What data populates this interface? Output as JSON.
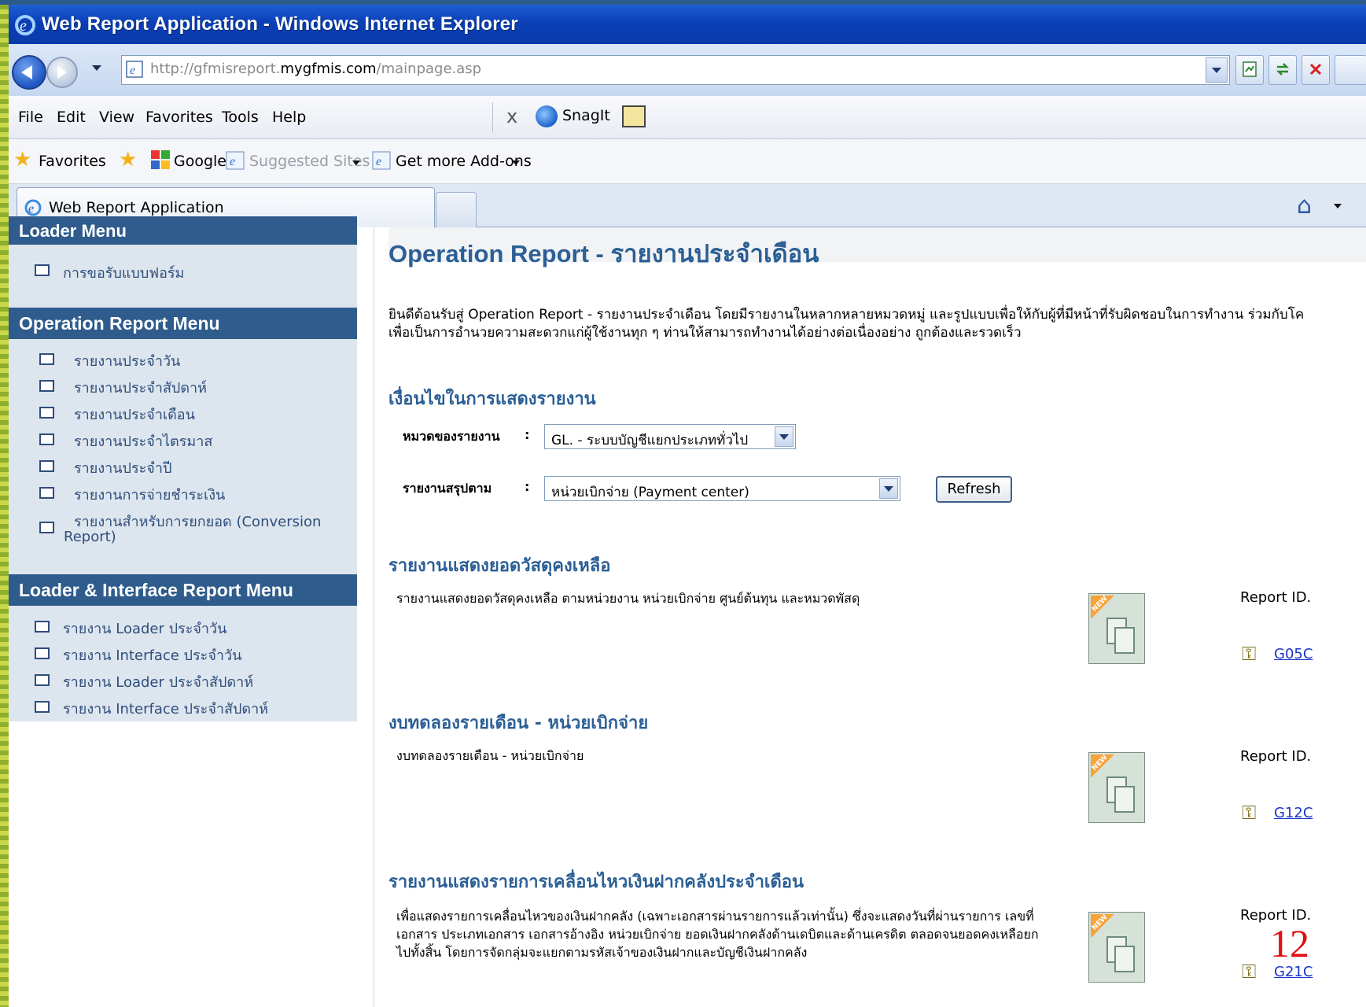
{
  "window": {
    "title": "Web Report Application - Windows Internet Explorer"
  },
  "address": {
    "url_prefix": "http://gfmisreport.",
    "url_domain": "mygfmis.com",
    "url_suffix": "/mainpage.asp"
  },
  "menubar": {
    "items": [
      "File",
      "Edit",
      "View",
      "Favorites",
      "Tools",
      "Help"
    ],
    "close_glyph": "x",
    "snagit_label": "SnagIt"
  },
  "favbar": {
    "favorites_label": "Favorites",
    "google_label": "Google",
    "suggested_label": "Suggested Sites",
    "addons_label": "Get more Add-ons"
  },
  "tabs": {
    "active_label": "Web Report Application"
  },
  "sidebar": {
    "loader_head": "Loader Menu",
    "loader_items": [
      "การขอรับแบบฟอร์ม"
    ],
    "operation_head": "Operation Report Menu",
    "operation_items": [
      "รายงานประจำวัน",
      "รายงานประจำสัปดาห์",
      "รายงานประจำเดือน",
      "รายงานประจำไตรมาส",
      "รายงานประจำปี",
      "รายงานการจ่ายชำระเงิน",
      "รายงานสำหรับการยกยอด (Conversion",
      "Report)"
    ],
    "interface_head": "Loader & Interface Report Menu",
    "interface_items": [
      "รายงาน Loader ประจำวัน",
      "รายงาน Interface ประจำวัน",
      "รายงาน Loader ประจำสัปดาห์",
      "รายงาน Interface ประจำสัปดาห์"
    ]
  },
  "main": {
    "title": "Operation Report -  รายงานประจำเดือน",
    "intro_line1": "ยินดีต้อนรับสู่ Operation Report - รายงานประจำเดือน  โดยมีรายงานในหลากหลายหมวดหมู่ และรูปแบบเพื่อให้กับผู้ที่มีหน้าที่รับผิดชอบในการทำงาน ร่วมกับโค",
    "intro_line2": "เพื่อเป็นการอำนวยความสะดวกแก่ผู้ใช้งานทุก ๆ ท่านให้สามารถทำงานได้อย่างต่อเนื่องอย่าง ถูกต้องและรวดเร็ว",
    "conditions_head": "เงื่อนไขในการแสดงรายงาน",
    "category_label": "หมวดของรายงาน",
    "category_value": "GL. - ระบบบัญชีแยกประเภททั่วไป",
    "summary_label": "รายงานสรุปตาม",
    "summary_value": "หน่วยเบิกจ่าย (Payment center)",
    "colon": ":",
    "refresh_label": "Refresh",
    "new_badge": "NEW",
    "reports": [
      {
        "head": "รายงานแสดงยอดวัสดุคงเหลือ",
        "desc": "รายงานแสดงยอดวัสดุคงเหลือ ตามหน่วยงาน หน่วยเบิกจ่าย ศูนย์ต้นทุน และหมวดพัสดุ",
        "id_label": "Report ID.",
        "id": "G05C"
      },
      {
        "head": "งบทดลองรายเดือน - หน่วยเบิกจ่าย",
        "desc": "งบทดลองรายเดือน - หน่วยเบิกจ่าย",
        "id_label": "Report ID.",
        "id": "G12C"
      },
      {
        "head": "รายงานแสดงรายการเคลื่อนไหวเงินฝากคลังประจำเดือน",
        "desc": "เพื่อแสดงรายการเคลื่อนไหวของเงินฝากคลัง (เฉพาะเอกสารผ่านรายการแล้วเท่านั้น) ซึ่งจะแสดงวันที่ผ่านรายการ เลขที่เอกสาร ประเภทเอกสาร เอกสารอ้างอิง หน่วยเบิกจ่าย ยอดเงินฝากคลังด้านเดบิตและด้านเครดิต ตลอดจนยอดคงเหลือยกไปทั้งสิ้น โดยการจัดกลุ่มจะแยกตามรหัสเจ้าของเงินฝากและบัญชีเงินฝากคลัง",
        "id_label": "Report ID.",
        "id": "G21C"
      }
    ]
  },
  "slide_number": "12",
  "colors": {
    "brand_blue": "#2b5f95",
    "sidebar_head": "#2f5c8c",
    "slide_number": "#e01010"
  }
}
